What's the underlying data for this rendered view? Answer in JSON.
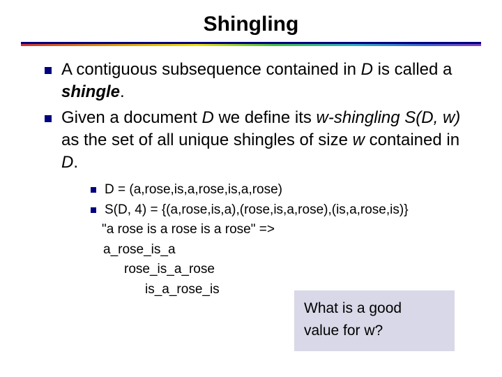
{
  "title": "Shingling",
  "bullets": [
    {
      "pre": "A contiguous subsequence contained in ",
      "D": "D",
      "mid": " is called a ",
      "shingle": "shingle",
      "post": "."
    },
    {
      "pre": "Given a document ",
      "D": "D",
      "mid1": " we define its ",
      "wshingling": "w-shingling",
      "SDw": "S(D, w)",
      "mid2": " as the set of all unique shingles of size ",
      "w": "w",
      "mid3": " contained in ",
      "D2": "D",
      "post": "."
    }
  ],
  "sub": {
    "line1": "D = (a,rose,is,a,rose,is,a,rose)",
    "line2": "S(D, 4) = {(a,rose,is,a),(rose,is,a,rose),(is,a,rose,is)}",
    "quote": "\"a rose is a rose is a rose\" =>",
    "s1": "a_rose_is_a",
    "s2": "rose_is_a_rose",
    "s3": "is_a_rose_is"
  },
  "callout": {
    "line1": "What is a good",
    "line2": "value for w?"
  }
}
